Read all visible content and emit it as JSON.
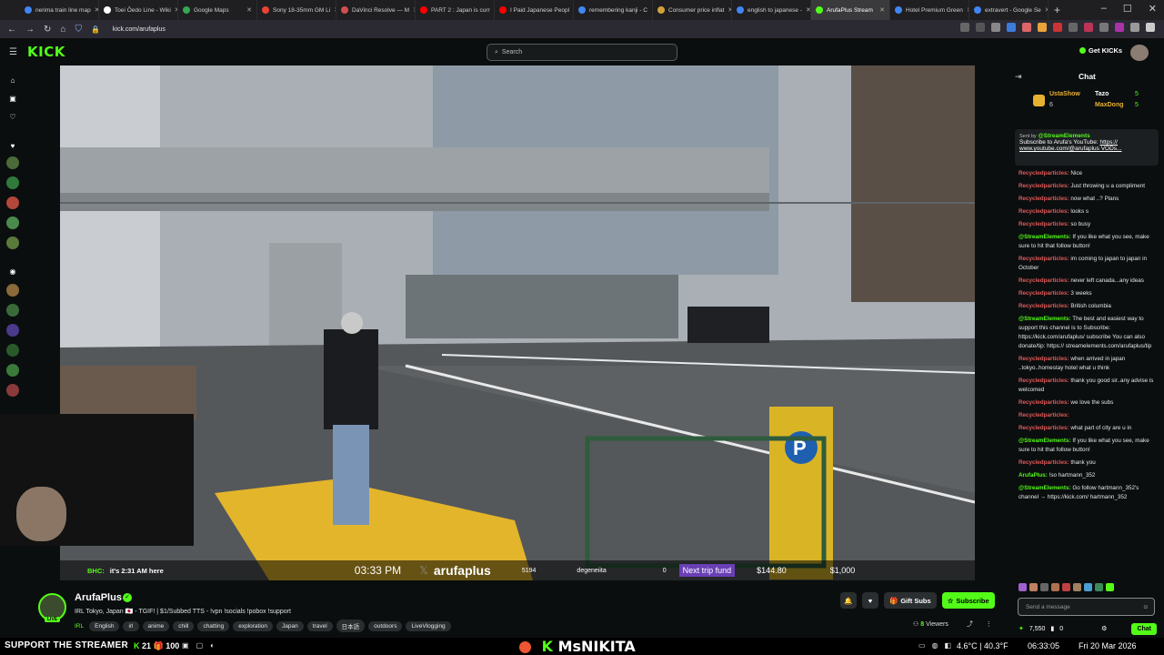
{
  "browser": {
    "tabs": [
      {
        "label": "nerima train line map",
        "color": "#4285f4"
      },
      {
        "label": "Toei Ōedo Line - Wiki",
        "color": "#ffffff"
      },
      {
        "label": "Google Maps",
        "color": "#34a853"
      },
      {
        "label": "Sony 18-35mm GM Li",
        "color": "#ea4335"
      },
      {
        "label": "DaVinci Resolve — M",
        "color": "#d24e4e"
      },
      {
        "label": "PART 2 : Japan is curr",
        "color": "#ff0000"
      },
      {
        "label": "I Paid Japanese Peopl",
        "color": "#ff0000"
      },
      {
        "label": "remembering kanji - C",
        "color": "#4285f4"
      },
      {
        "label": "Consumer price inflat",
        "color": "#d1a33a"
      },
      {
        "label": "english to japanese - ",
        "color": "#4285f4"
      },
      {
        "label": "ArufaPlus Stream",
        "color": "#53fc18",
        "active": true
      },
      {
        "label": "Hotel Premium Green",
        "color": "#4285f4"
      },
      {
        "label": "extravert - Google Se",
        "color": "#4285f4"
      }
    ],
    "url": "kick.com/arufaplus"
  },
  "header": {
    "logo": "KICK",
    "search_placeholder": "Search",
    "get_kicks": "Get KICKs"
  },
  "video": {
    "overlay_msg_user": "BHC:",
    "overlay_msg_text": "it's 2:31 AM here",
    "time": "03:33 PM",
    "handle": "arufaplus",
    "count": "5194",
    "donor": "degeneiita",
    "zero": "0",
    "trip_label": "Next trip fund",
    "trip_current": "$144.80",
    "trip_goal": "$1,000"
  },
  "streamer": {
    "name": "ArufaPlus",
    "live": "LIVE",
    "title": "IRL Tokyo, Japan 🇯🇵 - TGIF! | $1/Subbed TTS - !vpn !socials !pobox !support",
    "category": "IRL",
    "tags": [
      "English",
      "irl",
      "anime",
      "chill",
      "chatting",
      "exploration",
      "Japan",
      "travel",
      "日本語",
      "outdoors",
      "LiveVlogging"
    ],
    "gift_subs": "Gift Subs",
    "subscribe": "Subscribe",
    "viewers_count": "8",
    "viewers_label": "Viewers"
  },
  "chat": {
    "title": "Chat",
    "gifters": [
      {
        "name": "UstaShow",
        "count": "6"
      },
      {
        "name": "Tazo",
        "count": "5"
      },
      {
        "name": "MaxDong",
        "count": "5"
      }
    ],
    "pinned": {
      "sent_by": "Sent by",
      "user": "@StreamElements",
      "text": "Subscribe to Arufa's YouTube:",
      "link": "https:// www.youtube.com/@arufaplus VODs..."
    },
    "messages": [
      {
        "user": "Recycledparticles:",
        "text": "Nice",
        "color": "#e05a5a"
      },
      {
        "user": "Recycledparticles:",
        "text": "Just throwing u a compliment",
        "color": "#e05a5a"
      },
      {
        "user": "Recycledparticles:",
        "text": "now what ..? Plans",
        "color": "#e05a5a"
      },
      {
        "user": "Recycledparticles:",
        "text": "looks s",
        "color": "#e05a5a"
      },
      {
        "user": "Recycledparticles:",
        "text": "so busy",
        "color": "#e05a5a"
      },
      {
        "user": "@StreamElements:",
        "text": "If you like what you see, make sure to hit that follow button!",
        "color": "#53fc18"
      },
      {
        "user": "Recycledparticles:",
        "text": "im coming to japan to japan in October",
        "color": "#e05a5a"
      },
      {
        "user": "Recycledparticles:",
        "text": "never left canada...any ideas",
        "color": "#e05a5a"
      },
      {
        "user": "Recycledparticles:",
        "text": "3 weeks",
        "color": "#e05a5a"
      },
      {
        "user": "Recycledparticles:",
        "text": "British columbia",
        "color": "#e05a5a"
      },
      {
        "user": "@StreamElements:",
        "text": "The best and easiest way to support this channel is to Subscribe: https://kick.com/arufaplus/ subscribe You can also donate/tip: https:// streamelements.com/arufaplus/tip",
        "color": "#53fc18"
      },
      {
        "user": "Recycledparticles:",
        "text": "when arrived in japan ..tokyo..homestay hotel what u think",
        "color": "#e05a5a"
      },
      {
        "user": "Recycledparticles:",
        "text": "thank you good sir..any advise is welcomed",
        "color": "#e05a5a"
      },
      {
        "user": "Recycledparticles:",
        "text": "we love the subs",
        "color": "#e05a5a"
      },
      {
        "user": "Recycledparticles:",
        "text": "",
        "color": "#e05a5a"
      },
      {
        "user": "Recycledparticles:",
        "text": "what part of city are u in",
        "color": "#e05a5a"
      },
      {
        "user": "@StreamElements:",
        "text": "If you like what you see, make sure to hit that follow button!",
        "color": "#53fc18"
      },
      {
        "user": "Recycledparticles:",
        "text": "thank you",
        "color": "#e05a5a"
      },
      {
        "user": "ArufaPlus:",
        "text": "!so hartmann_352",
        "color": "#53fc18"
      },
      {
        "user": "@StreamElements:",
        "text": "Go follow hartmann_352's channel → https://kick.com/ hartmann_352",
        "color": "#53fc18"
      }
    ],
    "input_placeholder": "Send a message",
    "points": "7,550",
    "zero": "0",
    "chat_button": "Chat"
  },
  "taskbar": {
    "support": "SUPPORT THE STREAMER",
    "ticker_a": "21",
    "ticker_b": "100",
    "brand_k": "K",
    "brand": "MsNIKITA",
    "temp": "4.6°C | 40.3°F",
    "clock": "06:33:05",
    "date": "Fri 20 Mar 2026"
  }
}
